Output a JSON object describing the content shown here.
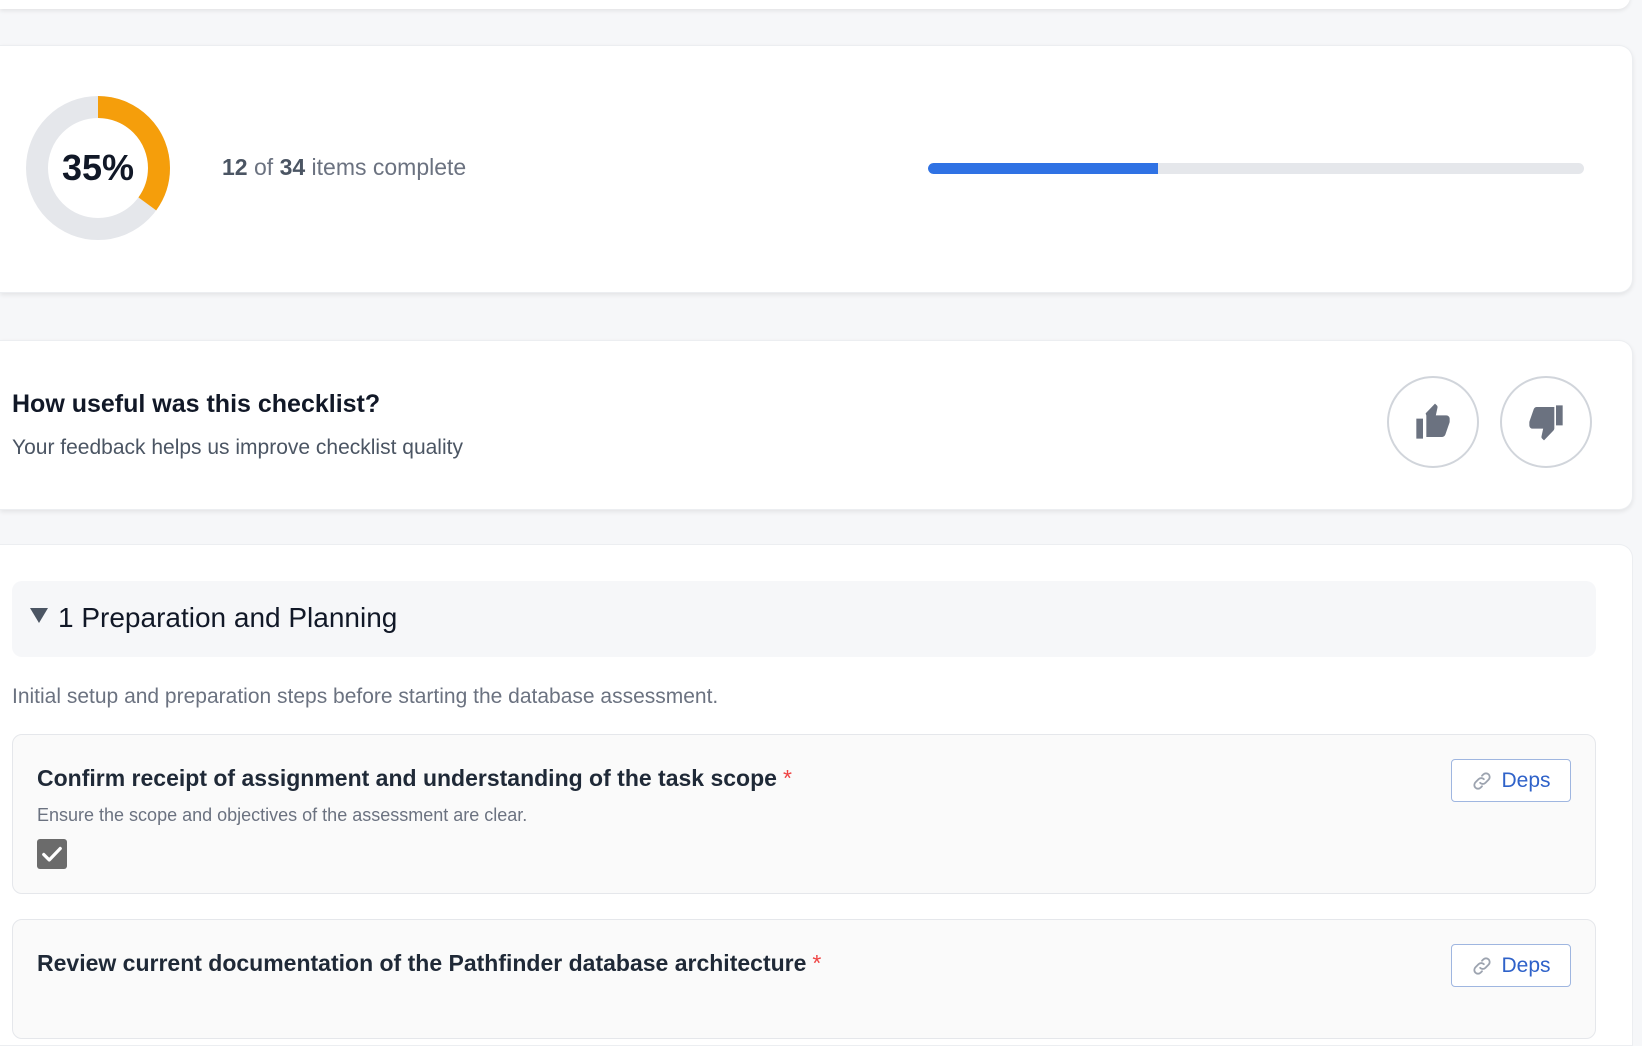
{
  "progress": {
    "percent_label": "35%",
    "percent_value": 0.35,
    "completed": "12",
    "of_word": "of",
    "total": "34",
    "suffix": "items complete",
    "bar_fraction": 0.35,
    "donut_color": "#f59e0b",
    "bar_color": "#2f72e4"
  },
  "feedback": {
    "title": "How useful was this checklist?",
    "subtitle": "Your feedback helps us improve checklist quality",
    "up_icon": "thumbs-up-icon",
    "down_icon": "thumbs-down-icon"
  },
  "section": {
    "title": "1 Preparation and Planning",
    "description": "Initial setup and preparation steps before starting the database assessment.",
    "items": [
      {
        "title": "Confirm receipt of assignment and understanding of the task scope",
        "required_mark": "*",
        "description": "Ensure the scope and objectives of the assessment are clear.",
        "checked": true,
        "deps_label": "Deps"
      },
      {
        "title": "Review current documentation of the Pathfinder database architecture",
        "required_mark": "*",
        "deps_label": "Deps"
      }
    ]
  }
}
